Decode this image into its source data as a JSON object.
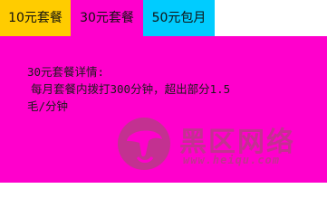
{
  "tabs": [
    {
      "label": "10元套餐",
      "color": "#ffcc00"
    },
    {
      "label": "30元套餐",
      "color": "#ff00cc",
      "active": true
    },
    {
      "label": "50元包月",
      "color": "#00ccff"
    }
  ],
  "panel": {
    "title": "30元套餐详情:",
    "lines": [
      "每月套餐内拨打300分钟，超出部分1.5",
      "毛/分钟"
    ]
  },
  "watermark": {
    "title": "黑区网络",
    "url": "www.heiqu.com",
    "logo_icon": "mushroom-logo-icon",
    "color": "#b0427e"
  }
}
